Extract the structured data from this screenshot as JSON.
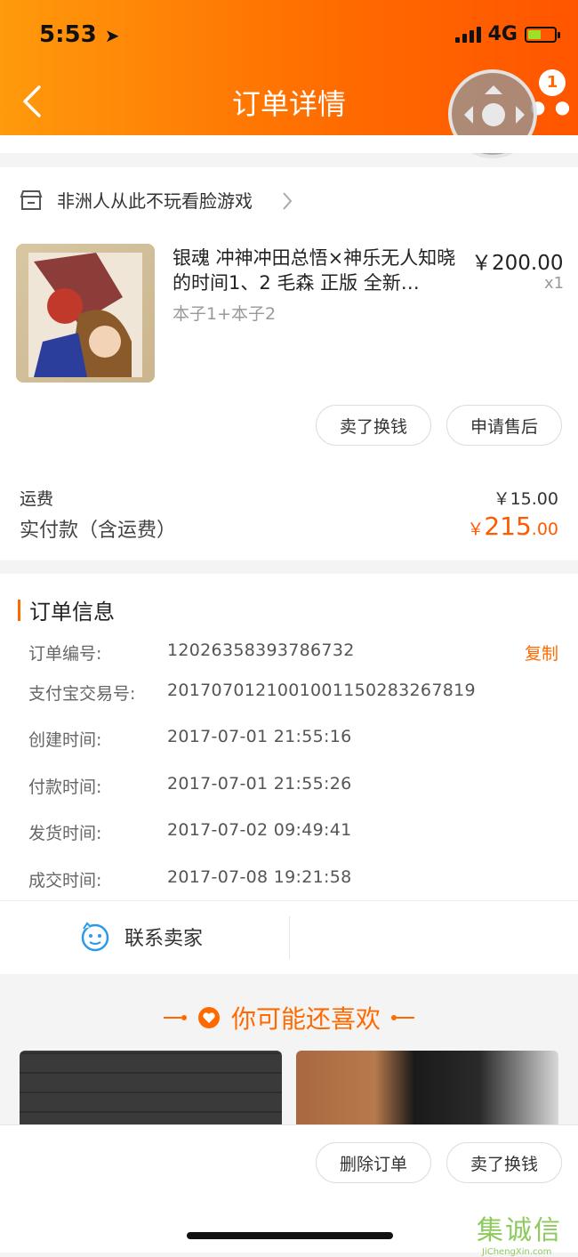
{
  "status": {
    "time": "5:53",
    "network": "4G"
  },
  "header": {
    "title": "订单详情",
    "badge_count": "1"
  },
  "shop": {
    "name": "非洲人从此不玩看脸游戏"
  },
  "product": {
    "title": "银魂 冲神冲田总悟×神乐无人知晓的时间1、2 毛森 正版 全新…",
    "spec": "本子1+本子2",
    "price": "￥200.00",
    "qty": "x1"
  },
  "item_actions": {
    "sell": "卖了换钱",
    "after_sale": "申请售后"
  },
  "totals": {
    "shipping_label": "运费",
    "shipping_value": "￥15.00",
    "paid_label": "实付款（含运费）",
    "paid_currency": "￥",
    "paid_int": "215",
    "paid_dec": ".00"
  },
  "order_info": {
    "heading": "订单信息",
    "copy_label": "复制",
    "rows": [
      {
        "label": "订单编号:",
        "value": "12026358393786732"
      },
      {
        "label": "支付宝交易号:",
        "value": "2017070121001001150283267819"
      },
      {
        "label": "创建时间:",
        "value": "2017-07-01 21:55:16"
      },
      {
        "label": "付款时间:",
        "value": "2017-07-01 21:55:26"
      },
      {
        "label": "发货时间:",
        "value": "2017-07-02 09:49:41"
      },
      {
        "label": "成交时间:",
        "value": "2017-07-08 19:21:58"
      }
    ]
  },
  "contact": {
    "label": "联系卖家"
  },
  "recommend": {
    "title": "你可能还喜欢"
  },
  "bottom_actions": {
    "delete": "删除订单",
    "sell": "卖了换钱"
  },
  "watermark": {
    "title": "集诚信",
    "site": "JiChengXin.com"
  },
  "colors": {
    "accent": "#ff6a00",
    "header_start": "#ff9a0c",
    "header_end": "#ff5500"
  }
}
